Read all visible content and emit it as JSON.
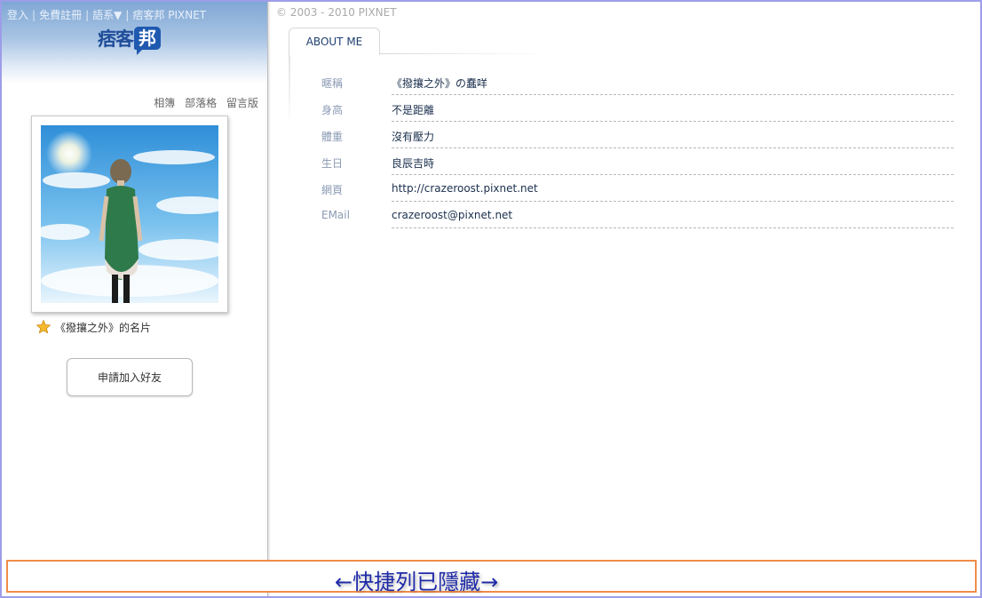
{
  "header": {
    "top_links": [
      "登入",
      "免費註冊",
      "語系▼",
      "痞客邦 PIXNET"
    ],
    "logo_text": "痞客",
    "logo_bubble": "邦"
  },
  "sidebar": {
    "nav": [
      "相簿",
      "部落格",
      "留言版"
    ],
    "card_caption": "《撥攘之外》的名片",
    "friend_button": "申請加入好友"
  },
  "main": {
    "copyright": "© 2003 - 2010 PIXNET",
    "tab_label": "ABOUT ME",
    "rows": [
      {
        "label": "暱稱",
        "value": "《撥攘之外》の蠢咩"
      },
      {
        "label": "身高",
        "value": "不是距離"
      },
      {
        "label": "體重",
        "value": "沒有壓力"
      },
      {
        "label": "生日",
        "value": "良辰吉時"
      },
      {
        "label": "網頁",
        "value": "http://crazeroost.pixnet.net"
      },
      {
        "label": "EMail",
        "value": "crazeroost@pixnet.net"
      }
    ]
  },
  "quickbar": {
    "text": "←快捷列已隱藏→"
  },
  "colors": {
    "accent": "#1f5ab0",
    "quickbar_border": "#f08c4a",
    "quickbar_text": "#1f2aa8",
    "frame_border": "#9d9de8"
  }
}
